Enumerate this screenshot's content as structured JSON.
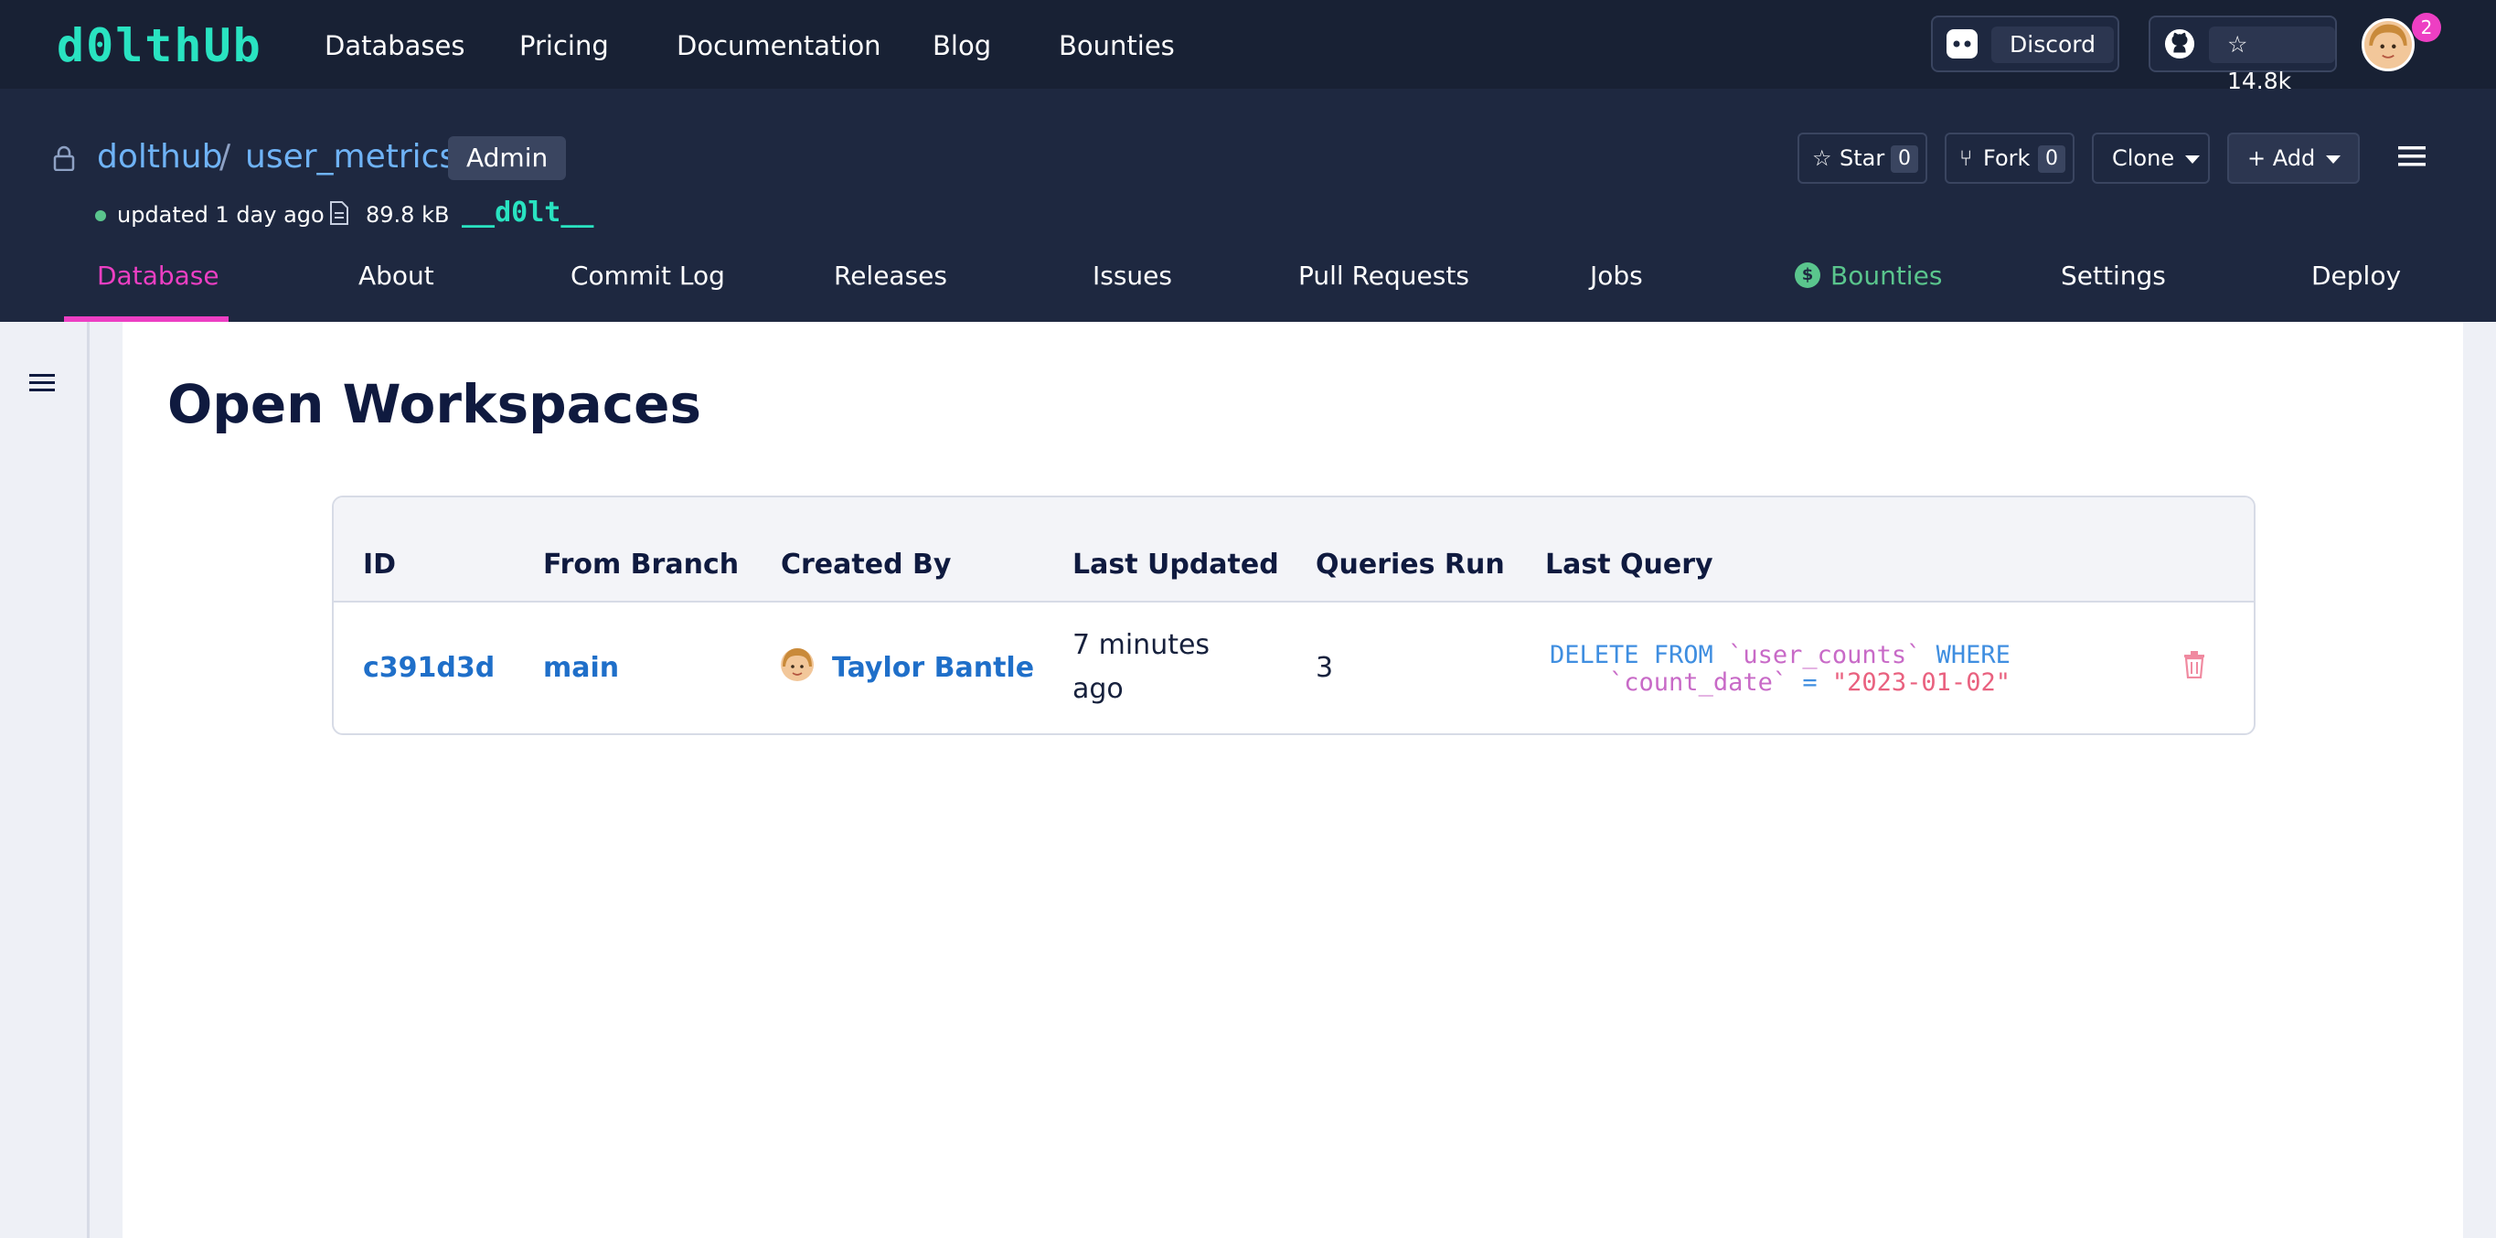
{
  "topnav": {
    "logo": "d0lthUb",
    "links": [
      "Databases",
      "Pricing",
      "Documentation",
      "Blog",
      "Bounties"
    ],
    "discord_label": "Discord",
    "github_stars": "14.8k",
    "notification_count": "2"
  },
  "repo": {
    "owner": "dolthub",
    "separator": "/",
    "name": "user_metrics",
    "role_badge": "Admin",
    "updated": "updated 1 day ago",
    "size": "89.8 kB",
    "dolt_tag": "__d0lt__",
    "star_label": "Star",
    "star_count": "0",
    "fork_label": "Fork",
    "fork_count": "0",
    "clone_label": "Clone",
    "add_label": "Add"
  },
  "tabs": [
    "Database",
    "About",
    "Commit Log",
    "Releases",
    "Issues",
    "Pull Requests",
    "Jobs",
    "Bounties",
    "Settings",
    "Deploy"
  ],
  "active_tab": "Database",
  "page": {
    "title": "Open Workspaces"
  },
  "table": {
    "headers": [
      "ID",
      "From Branch",
      "Created By",
      "Last Updated",
      "Queries Run",
      "Last Query"
    ],
    "rows": [
      {
        "id": "c391d3d",
        "branch": "main",
        "creator": "Taylor Bantle",
        "updated_line1": "7 minutes",
        "updated_line2": "ago",
        "queries": "3",
        "query": {
          "kw1": "DELETE FROM ",
          "table": "`user_counts`",
          "kw2": " WHERE",
          "col": "`count_date`",
          "op": " = ",
          "value": "\"2023-01-02\""
        }
      }
    ]
  },
  "colors": {
    "nav_bg": "#182134",
    "header_bg": "#1e2840",
    "accent_pink": "#ed3fc3",
    "accent_teal": "#29e3c1",
    "link_blue": "#1f6fc9"
  }
}
